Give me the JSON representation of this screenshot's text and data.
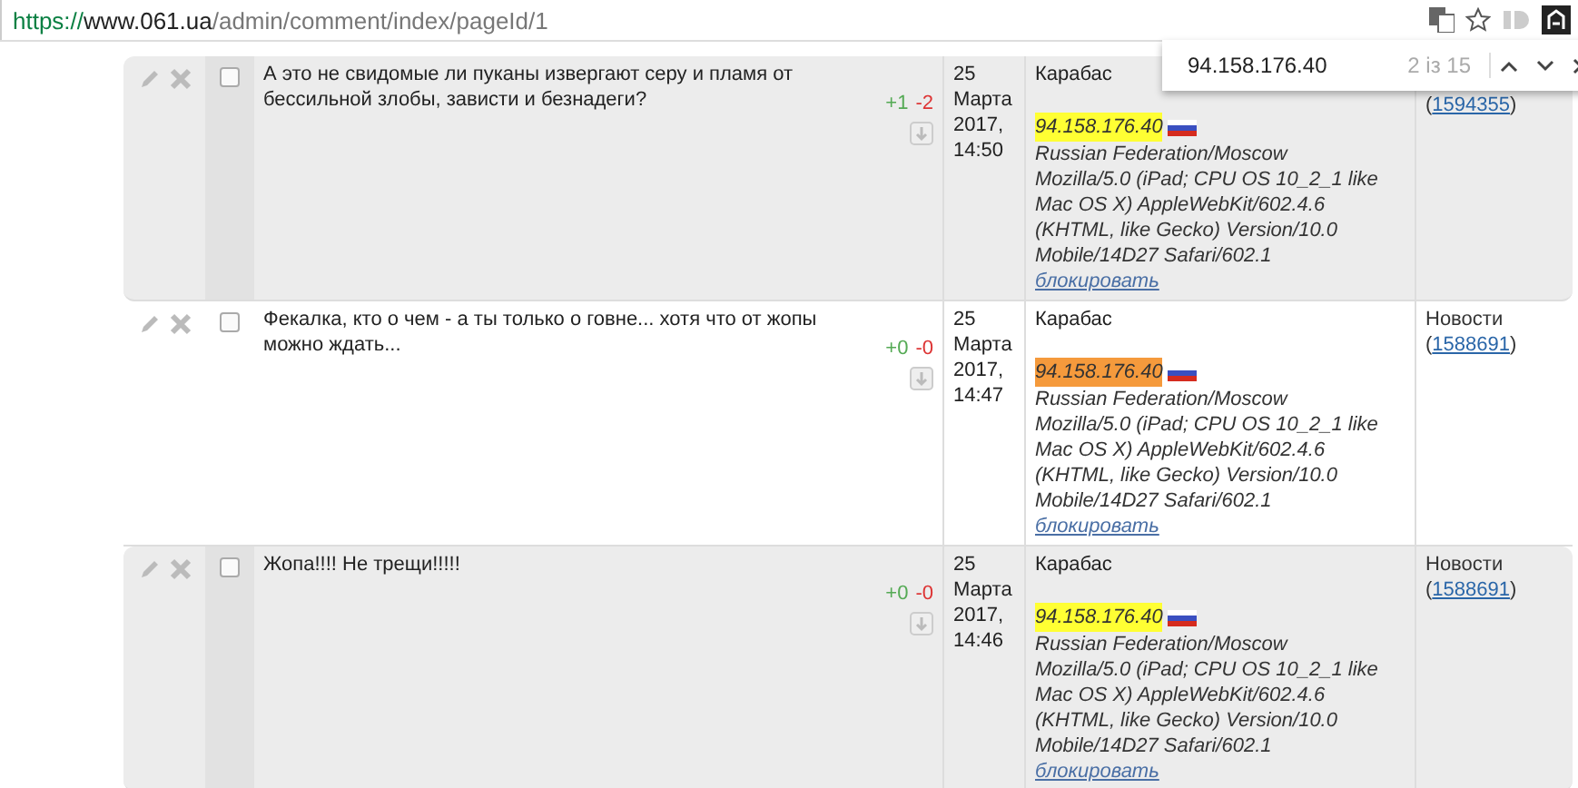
{
  "browser": {
    "url": {
      "scheme": "https://",
      "host": "www.061.ua",
      "path": "/admin/comment/index/pageId/1"
    }
  },
  "find_bar": {
    "query": "94.158.176.40",
    "count": "2 із 15"
  },
  "rows": [
    {
      "shaded": true,
      "checked": false,
      "comment": "А это не свидомые ли пуканы извергают серу и пламя от бессильной злобы, зависти и безнадеги?",
      "plus": "+1",
      "minus": "-2",
      "date": "25 Марта 2017, 14:50",
      "author": "Карабас",
      "ip": "94.158.176.40",
      "ip_current": false,
      "location": "Russian Federation/Moscow",
      "user_agent": "Mozilla/5.0 (iPad; CPU OS 10_2_1 like Mac OS X) AppleWebKit/602.4.6 (KHTML, like Gecko) Version/10.0 Mobile/14D27 Safari/602.1",
      "block": "блокировать",
      "section_ref": {
        "before": "(",
        "id": "1594355",
        "after": ")"
      }
    },
    {
      "shaded": false,
      "checked": false,
      "comment": "Фекалка, кто о чем - а ты только о говне... хотя что от жопы можно ждать...",
      "plus": "+0",
      "minus": "-0",
      "date": "25 Марта 2017, 14:47",
      "author": "Карабас",
      "ip": "94.158.176.40",
      "ip_current": true,
      "location": "Russian Federation/Moscow",
      "user_agent": "Mozilla/5.0 (iPad; CPU OS 10_2_1 like Mac OS X) AppleWebKit/602.4.6 (KHTML, like Gecko) Version/10.0 Mobile/14D27 Safari/602.1",
      "block": "блокировать",
      "section": "Новости",
      "section_ref": {
        "before": "(",
        "id": "1588691",
        "after": ")"
      }
    },
    {
      "shaded": true,
      "checked": false,
      "comment": "Жопа!!!! Не трещи!!!!!",
      "plus": "+0",
      "minus": "-0",
      "date": "25 Марта 2017, 14:46",
      "author": "Карабас",
      "ip": "94.158.176.40",
      "ip_current": false,
      "location": "Russian Federation/Moscow",
      "user_agent": "Mozilla/5.0 (iPad; CPU OS 10_2_1 like Mac OS X) AppleWebKit/602.4.6 (KHTML, like Gecko) Version/10.0 Mobile/14D27 Safari/602.1",
      "block": "блокировать",
      "section": "Новости",
      "section_ref": {
        "before": "(",
        "id": "1588691",
        "after": ")"
      }
    }
  ]
}
